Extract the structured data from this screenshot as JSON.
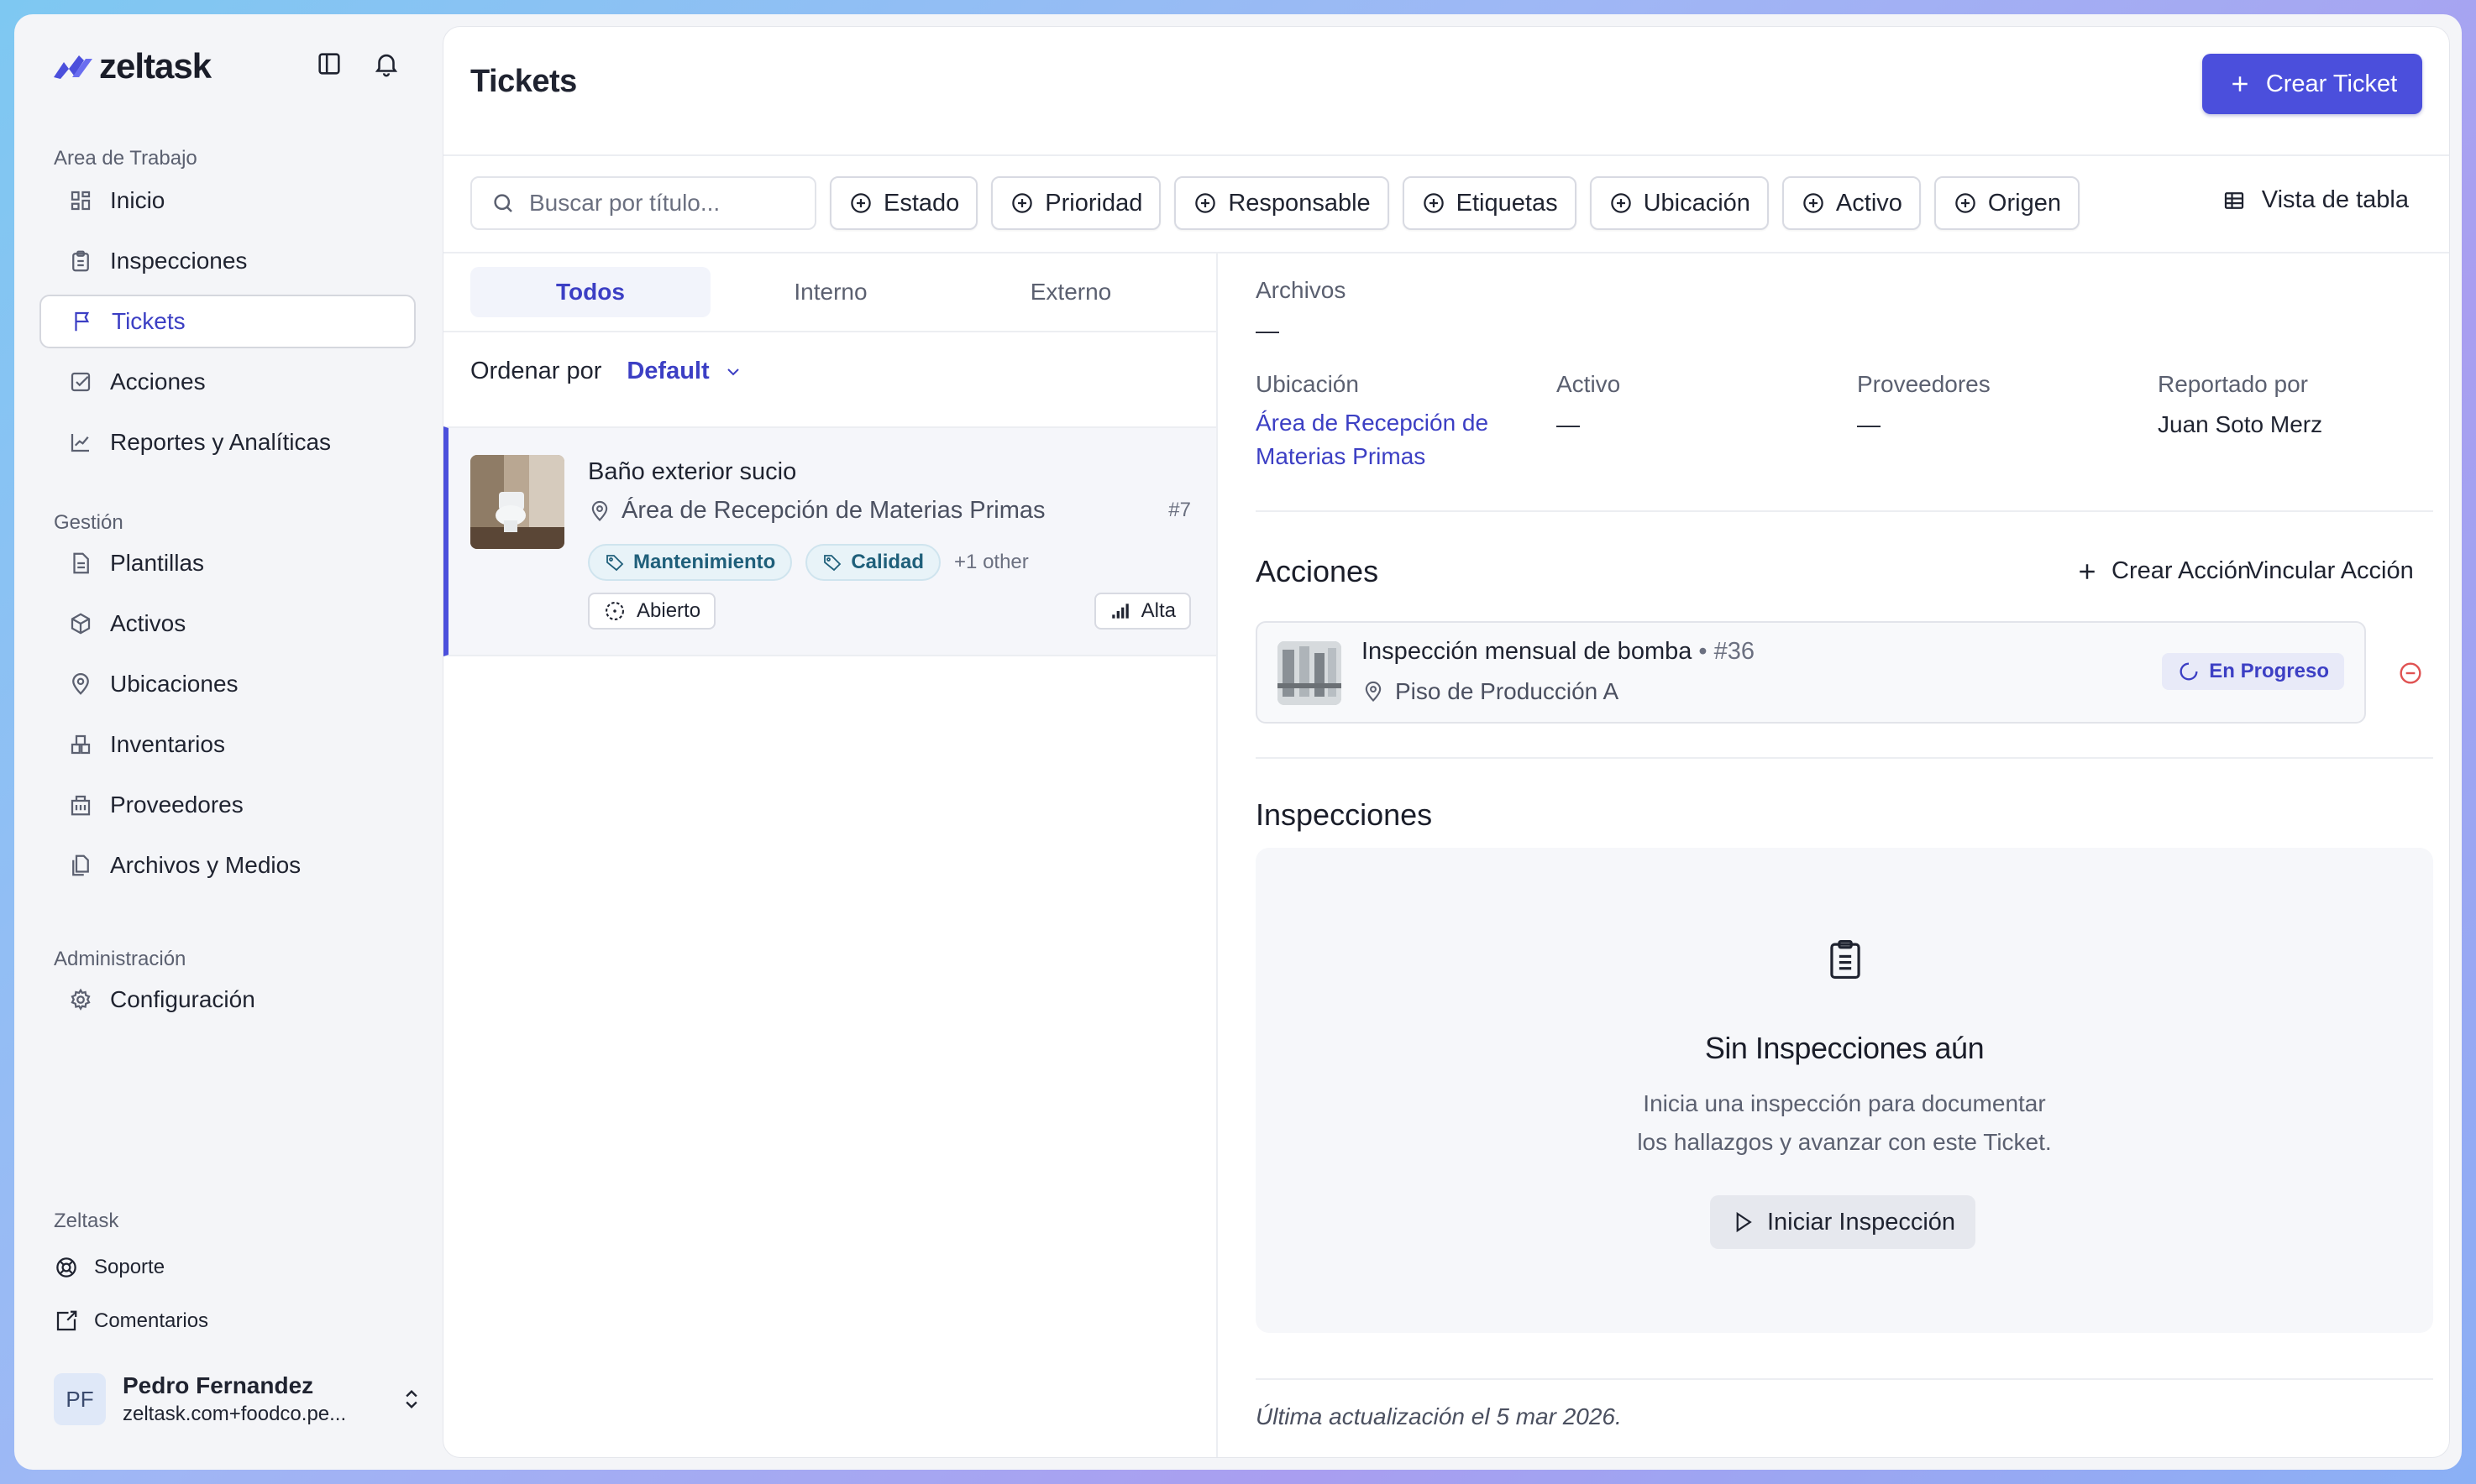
{
  "app": {
    "name": "zeltask"
  },
  "sidebar": {
    "workspace_title": "Area de Trabajo",
    "workspace_items": [
      {
        "label": "Inicio",
        "icon": "home-grid-icon"
      },
      {
        "label": "Inspecciones",
        "icon": "clipboard-icon"
      },
      {
        "label": "Tickets",
        "icon": "flag-icon",
        "active": true
      },
      {
        "label": "Acciones",
        "icon": "check-square-icon"
      },
      {
        "label": "Reportes y Analíticas",
        "icon": "chart-line-icon"
      }
    ],
    "management_title": "Gestión",
    "management_items": [
      {
        "label": "Plantillas",
        "icon": "document-icon"
      },
      {
        "label": "Activos",
        "icon": "cube-icon"
      },
      {
        "label": "Ubicaciones",
        "icon": "map-pin-icon"
      },
      {
        "label": "Inventarios",
        "icon": "boxes-icon"
      },
      {
        "label": "Proveedores",
        "icon": "building-icon"
      },
      {
        "label": "Archivos y Medios",
        "icon": "files-icon"
      }
    ],
    "admin_title": "Administración",
    "admin_items": [
      {
        "label": "Configuración",
        "icon": "gear-icon"
      }
    ],
    "footer_title": "Zeltask",
    "footer_items": [
      {
        "label": "Soporte",
        "icon": "lifebuoy-icon"
      },
      {
        "label": "Comentarios",
        "icon": "feedback-icon"
      }
    ],
    "user": {
      "initials": "PF",
      "name": "Pedro Fernandez",
      "email": "zeltask.com+foodco.pe..."
    }
  },
  "header": {
    "title": "Tickets",
    "create_label": "Crear Ticket"
  },
  "filters": {
    "search_placeholder": "Buscar por título...",
    "chips": [
      "Estado",
      "Prioridad",
      "Responsable",
      "Etiquetas",
      "Ubicación",
      "Activo",
      "Origen"
    ],
    "table_view_label": "Vista de tabla"
  },
  "list": {
    "tabs": [
      "Todos",
      "Interno",
      "Externo"
    ],
    "sort_label": "Ordenar por",
    "sort_value": "Default",
    "tickets": [
      {
        "title": "Baño exterior sucio",
        "location": "Área de Recepción de Materias Primas",
        "number": "#7",
        "tags": [
          "Mantenimiento",
          "Calidad"
        ],
        "more_tags": "+1 other",
        "status": "Abierto",
        "priority": "Alta"
      }
    ]
  },
  "detail": {
    "files_label": "Archivos",
    "files_value": "—",
    "location_label": "Ubicación",
    "location_value": "Área de Recepción de Materias Primas",
    "asset_label": "Activo",
    "asset_value": "—",
    "vendors_label": "Proveedores",
    "vendors_value": "—",
    "reported_label": "Reportado por",
    "reported_value": "Juan Soto Merz",
    "actions_title": "Acciones",
    "create_action_label": "Crear Acción",
    "link_action_label": "Vincular Acción",
    "action": {
      "title": "Inspección mensual de bomba",
      "separator": "•",
      "number": "#36",
      "location": "Piso de Producción A",
      "status": "En Progreso"
    },
    "inspections_title": "Inspecciones",
    "empty_title": "Sin Inspecciones aún",
    "empty_desc_line1": "Inicia una inspección para documentar",
    "empty_desc_line2": "los hallazgos y avanzar con este Ticket.",
    "start_label": "Iniciar Inspección",
    "updated": "Última actualización el 5 mar 2026."
  },
  "colors": {
    "accent": "#4b4fdc",
    "link": "#3c3fc4",
    "tag_bg": "#e8f3f8",
    "remove": "#e05252"
  }
}
